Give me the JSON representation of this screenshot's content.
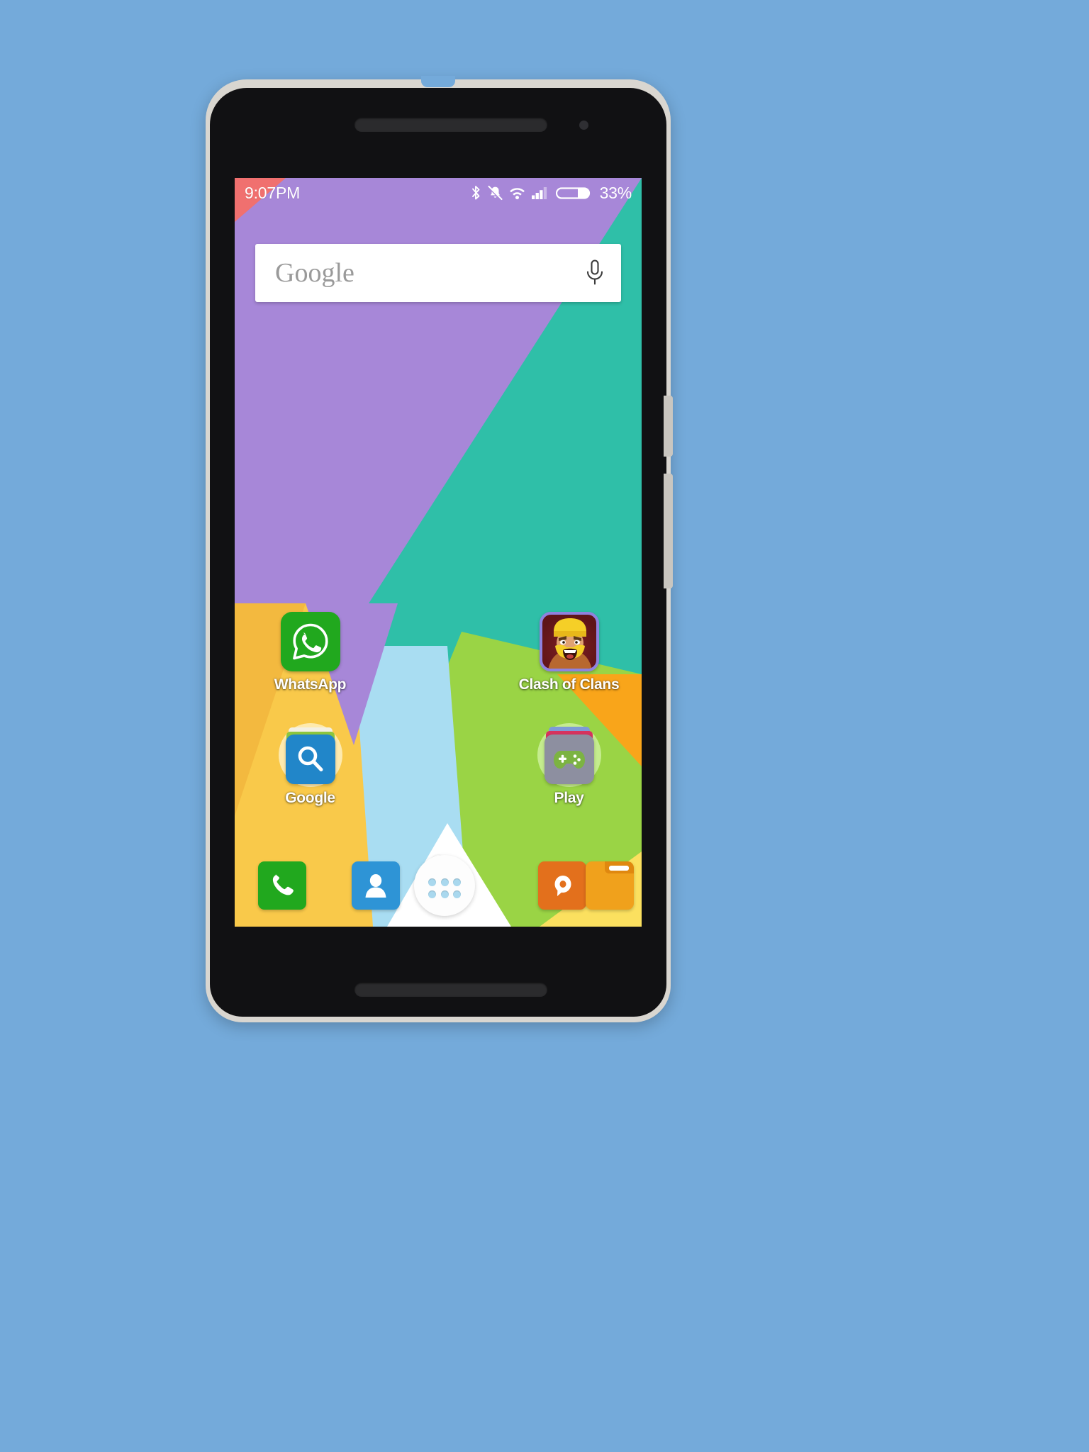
{
  "device": {
    "kind": "android-smartphone",
    "body_color": "#d9d6d0",
    "bezel_color": "#111113",
    "backdrop_color": "#74aada"
  },
  "status_bar": {
    "time": "9:07PM",
    "battery_percent_label": "33%",
    "battery_level": 33,
    "icons": [
      {
        "name": "bluetooth-icon",
        "label": "Bluetooth"
      },
      {
        "name": "vibrate-silent-icon",
        "label": "Ringer silenced"
      },
      {
        "name": "wifi-icon",
        "label": "Wi-Fi"
      },
      {
        "name": "cellular-signal-icon",
        "label": "Signal",
        "bars_filled": 3,
        "bars_total": 4
      },
      {
        "name": "battery-icon",
        "label": "Battery"
      }
    ],
    "text_color": "#ffffff"
  },
  "search_widget": {
    "provider_label": "Google",
    "placeholder": "Google",
    "mic_icon": "microphone-icon",
    "background": "#ffffff",
    "text_color": "#9a9a9a"
  },
  "home_screen": {
    "page_indicator": {
      "pages": 1,
      "current": 1
    },
    "apps": [
      {
        "label": "WhatsApp",
        "icon": "whatsapp-icon",
        "type": "app",
        "row": 1,
        "col": 1,
        "color": "#21a81e"
      },
      {
        "label": "Clash of Clans",
        "icon": "clash-of-clans-icon",
        "type": "app",
        "row": 1,
        "col": 4,
        "color": "#5e1418"
      },
      {
        "label": "Google",
        "icon": "google-search-icon",
        "type": "folder",
        "row": 2,
        "col": 1,
        "color": "#2186c9"
      },
      {
        "label": "Play",
        "icon": "play-games-icon",
        "type": "folder",
        "row": 2,
        "col": 4,
        "color": "#8d8fa0"
      }
    ]
  },
  "dock": {
    "items": [
      {
        "name": "phone-icon",
        "label": "Phone",
        "color": "#21a81e"
      },
      {
        "name": "contacts-icon",
        "label": "Contacts",
        "color": "#2e94d6"
      },
      {
        "name": "app-drawer-icon",
        "label": "All apps",
        "color": "#fdfdfd"
      },
      {
        "name": "messaging-icon",
        "label": "Messaging",
        "color": "#e3701c"
      },
      {
        "name": "file-manager-icon",
        "label": "File Manager",
        "color": "#f0a11c"
      }
    ]
  },
  "wallpaper": {
    "style": "flat-geometric-polygons",
    "colors": {
      "purple": "#a787d8",
      "teal": "#2fbfa8",
      "coral": "#f0706f",
      "green": "#9ad445",
      "yellow": "#f9c94a",
      "orange": "#f9a51a",
      "light_blue": "#a9ddf2",
      "pale_yellow": "#fbe05f",
      "white": "#ffffff"
    }
  }
}
